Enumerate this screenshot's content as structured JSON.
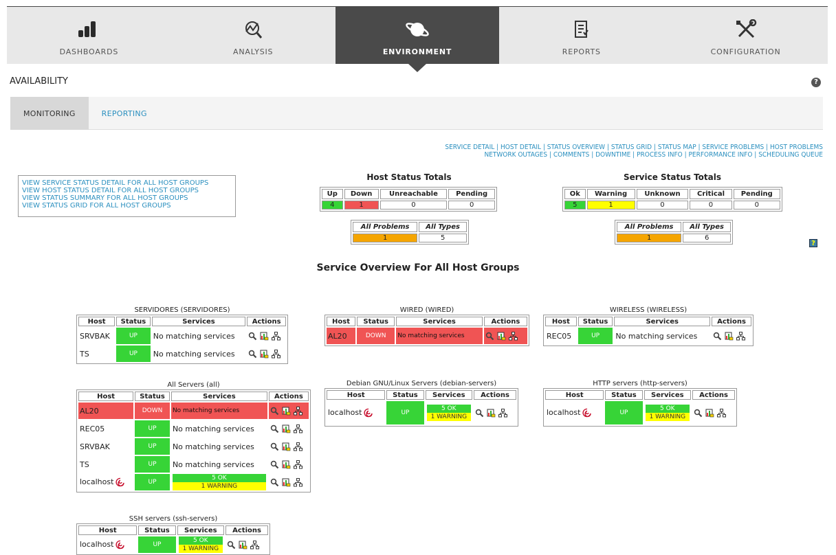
{
  "nav": {
    "tabs": [
      {
        "label": "DASHBOARDS",
        "icon": "bar-chart-icon"
      },
      {
        "label": "ANALYSIS",
        "icon": "analysis-icon"
      },
      {
        "label": "ENVIRONMENT",
        "icon": "planet-icon",
        "active": true
      },
      {
        "label": "REPORTS",
        "icon": "report-icon"
      },
      {
        "label": "CONFIGURATION",
        "icon": "tools-icon"
      }
    ]
  },
  "page": {
    "title": "AVAILABILITY",
    "help": "?"
  },
  "subtabs": {
    "monitoring": "MONITORING",
    "reporting": "REPORTING"
  },
  "toplinks": {
    "row1": [
      "SERVICE DETAIL",
      "HOST DETAIL",
      "STATUS OVERVIEW",
      "STATUS GRID",
      "STATUS MAP",
      "SERVICE PROBLEMS",
      "HOST PROBLEMS"
    ],
    "row2": [
      "NETWORK OUTAGES",
      "COMMENTS",
      "DOWNTIME",
      "PROCESS INFO",
      "PERFORMANCE INFO",
      "SCHEDULING QUEUE"
    ]
  },
  "viewlinks": [
    "VIEW SERVICE STATUS DETAIL FOR ALL HOST GROUPS",
    "VIEW HOST STATUS DETAIL FOR ALL HOST GROUPS",
    "VIEW STATUS SUMMARY FOR ALL HOST GROUPS",
    "VIEW STATUS GRID FOR ALL HOST GROUPS"
  ],
  "host_totals": {
    "title": "Host Status Totals",
    "headers": [
      "Up",
      "Down",
      "Unreachable",
      "Pending"
    ],
    "values": [
      "4",
      "1",
      "0",
      "0"
    ],
    "problems_headers": [
      "All Problems",
      "All Types"
    ],
    "problems_values": [
      "1",
      "5"
    ]
  },
  "service_totals": {
    "title": "Service Status Totals",
    "headers": [
      "Ok",
      "Warning",
      "Unknown",
      "Critical",
      "Pending"
    ],
    "values": [
      "5",
      "1",
      "0",
      "0",
      "0"
    ],
    "problems_headers": [
      "All Problems",
      "All Types"
    ],
    "problems_values": [
      "1",
      "6"
    ]
  },
  "overview_title": "Service Overview For All Host Groups",
  "table_headers": {
    "host": "Host",
    "status": "Status",
    "services": "Services",
    "actions": "Actions"
  },
  "groups": {
    "servidores": {
      "title": "SERVIDORES (SERVIDORES)",
      "rows": [
        {
          "host": "SRVBAK",
          "status": "UP",
          "services": "No matching services"
        },
        {
          "host": "TS",
          "status": "UP",
          "services": "No matching services"
        }
      ]
    },
    "wired": {
      "title": "WIRED (WIRED)",
      "rows": [
        {
          "host": "AL20",
          "status": "DOWN",
          "services": "No matching services"
        }
      ]
    },
    "wireless": {
      "title": "WIRELESS (WIRELESS)",
      "rows": [
        {
          "host": "REC05",
          "status": "UP",
          "services": "No matching services"
        }
      ]
    },
    "all": {
      "title": "All Servers (all)",
      "rows": [
        {
          "host": "AL20",
          "status": "DOWN",
          "services": "No matching services"
        },
        {
          "host": "REC05",
          "status": "UP",
          "services": "No matching services"
        },
        {
          "host": "SRVBAK",
          "status": "UP",
          "services": "No matching services"
        },
        {
          "host": "TS",
          "status": "UP",
          "services": "No matching services"
        },
        {
          "host": "localhost",
          "status": "UP",
          "ok": "5 OK",
          "warning": "1 WARNING"
        }
      ]
    },
    "debian": {
      "title": "Debian GNU/Linux Servers (debian-servers)",
      "rows": [
        {
          "host": "localhost",
          "status": "UP",
          "ok": "5 OK",
          "warning": "1 WARNING"
        }
      ]
    },
    "http": {
      "title": "HTTP servers (http-servers)",
      "rows": [
        {
          "host": "localhost",
          "status": "UP",
          "ok": "5 OK",
          "warning": "1 WARNING"
        }
      ]
    },
    "ssh": {
      "title": "SSH servers (ssh-servers)",
      "rows": [
        {
          "host": "localhost",
          "status": "UP",
          "ok": "5 OK",
          "warning": "1 WARNING"
        }
      ]
    }
  },
  "colors": {
    "up": "#37d437",
    "down": "#f05454",
    "warning": "#ffff00",
    "problem": "#f5a500",
    "link": "#2a8fbf",
    "nav_active": "#4a4a4a"
  }
}
